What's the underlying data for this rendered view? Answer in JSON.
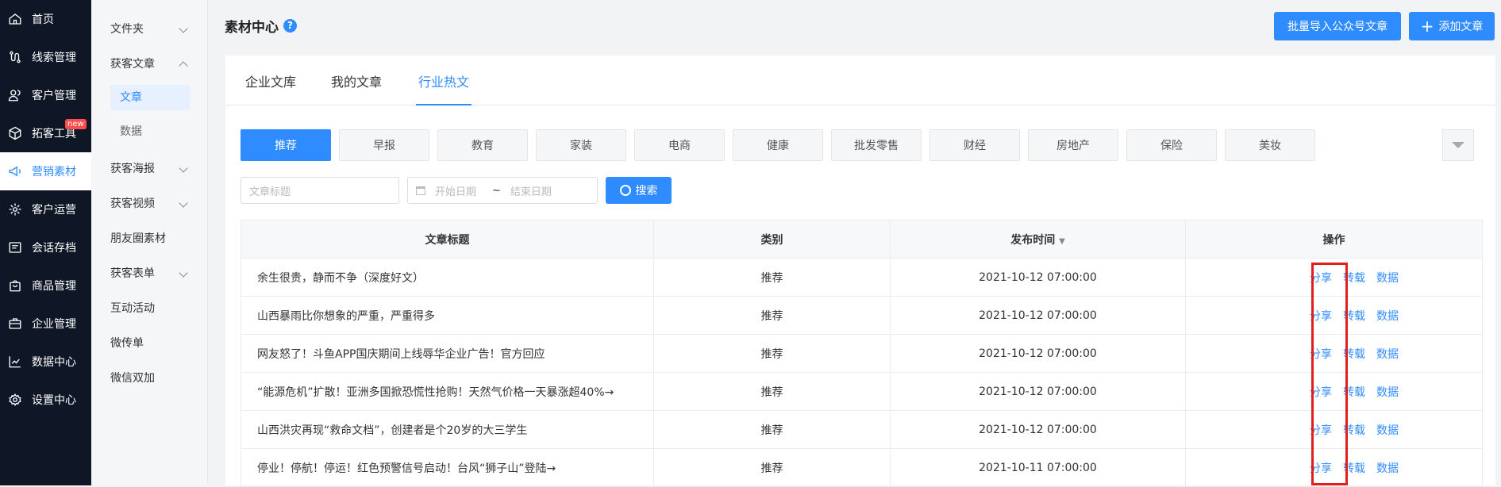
{
  "nav": [
    {
      "label": "首页",
      "icon": "home-icon"
    },
    {
      "label": "线索管理",
      "icon": "route-icon"
    },
    {
      "label": "客户管理",
      "icon": "users-icon"
    },
    {
      "label": "拓客工具",
      "icon": "cube-icon",
      "badge": "new"
    },
    {
      "label": "营销素材",
      "icon": "megaphone-icon",
      "active": true
    },
    {
      "label": "客户运营",
      "icon": "cog-users-icon"
    },
    {
      "label": "会话存档",
      "icon": "chat-archive-icon"
    },
    {
      "label": "商品管理",
      "icon": "bag-icon"
    },
    {
      "label": "企业管理",
      "icon": "briefcase-icon"
    },
    {
      "label": "数据中心",
      "icon": "chart-icon"
    },
    {
      "label": "设置中心",
      "icon": "settings-icon"
    }
  ],
  "sub": {
    "folder": "文件夹",
    "article_group": "获客文章",
    "article": "文章",
    "data": "数据",
    "poster": "获客海报",
    "video": "获客视频",
    "moments": "朋友圈素材",
    "form": "获客表单",
    "activity": "互动活动",
    "flyer": "微传单",
    "wechat_plus": "微信双加"
  },
  "header": {
    "title": "素材中心",
    "help": "?",
    "import_btn": "批量导入公众号文章",
    "add_btn": "添加文章",
    "add_icon": "+"
  },
  "tabs": [
    "企业文库",
    "我的文章",
    "行业热文"
  ],
  "categories": [
    "推荐",
    "早报",
    "教育",
    "家装",
    "电商",
    "健康",
    "批发零售",
    "财经",
    "房地产",
    "保险",
    "美妆"
  ],
  "filters": {
    "title_placeholder": "文章标题",
    "start_date": "开始日期",
    "sep": "~",
    "end_date": "结束日期",
    "search_btn": "搜索"
  },
  "table": {
    "headers": [
      "文章标题",
      "类别",
      "发布时间",
      "操作"
    ],
    "sort_icon": "▼",
    "actions": [
      "分享",
      "转载",
      "数据"
    ],
    "rows": [
      {
        "title": "余生很贵，静而不争（深度好文）",
        "cat": "推荐",
        "time": "2021-10-12 07:00:00"
      },
      {
        "title": "山西暴雨比你想象的严重，严重得多",
        "cat": "推荐",
        "time": "2021-10-12 07:00:00"
      },
      {
        "title": "网友怒了！斗鱼APP国庆期间上线辱华企业广告！官方回应",
        "cat": "推荐",
        "time": "2021-10-12 07:00:00"
      },
      {
        "title": "“能源危机”扩散！亚洲多国掀恐慌性抢购！天然气价格一天暴涨超40%→",
        "cat": "推荐",
        "time": "2021-10-12 07:00:00"
      },
      {
        "title": "山西洪灾再现“救命文档”，创建者是个20岁的大三学生",
        "cat": "推荐",
        "time": "2021-10-12 07:00:00"
      },
      {
        "title": "停业！停航！停运！红色预警信号启动！台风“狮子山”登陆→",
        "cat": "推荐",
        "time": "2021-10-11 07:00:00"
      }
    ]
  },
  "colors": {
    "accent": "#2f8cff",
    "nav_dark": "#0f1726",
    "highlight": "#e02020"
  }
}
